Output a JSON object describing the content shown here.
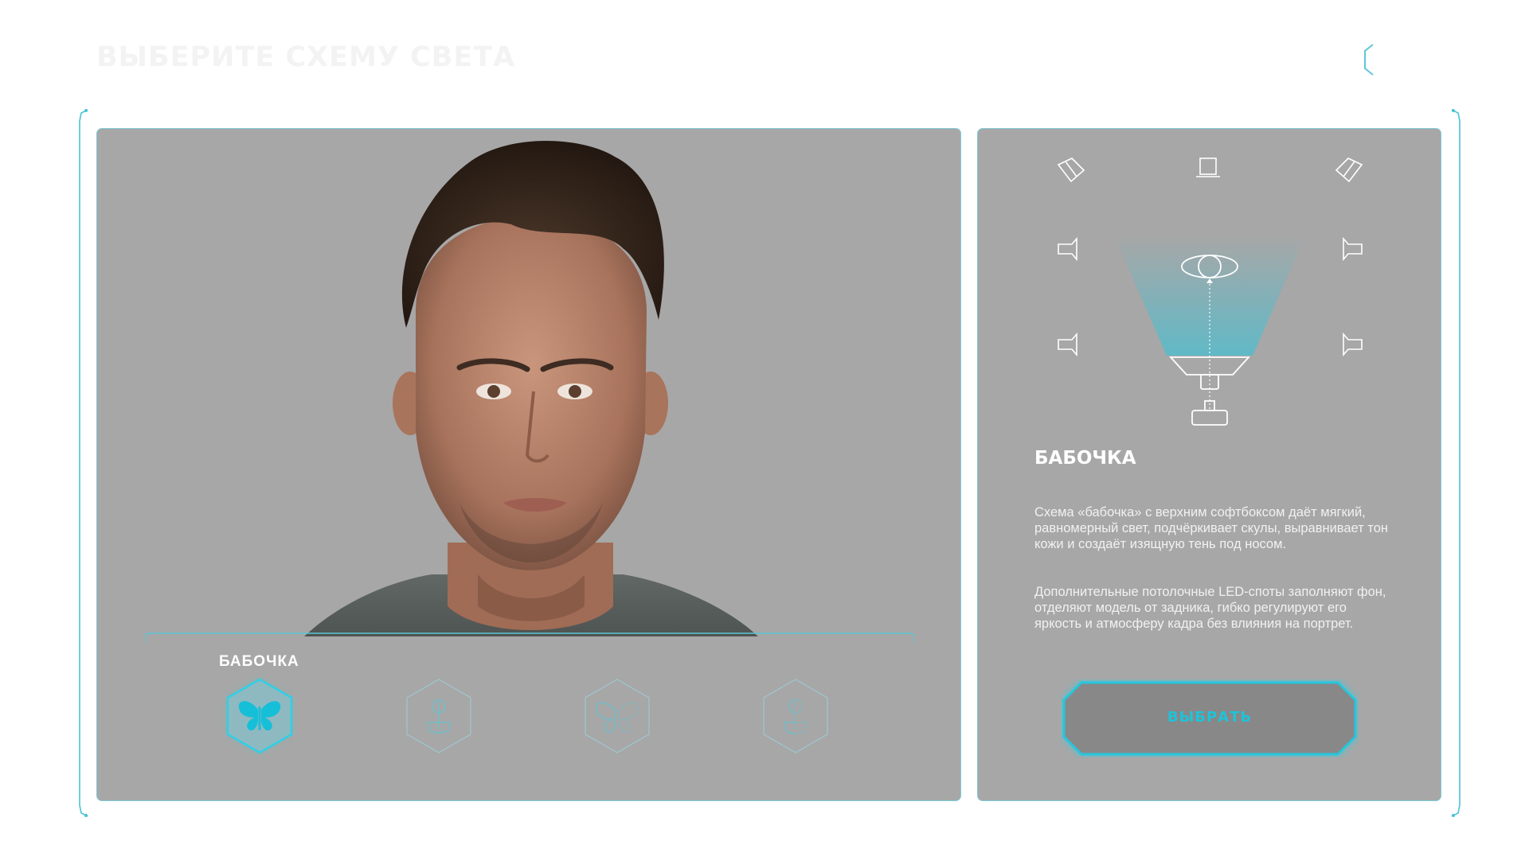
{
  "page": {
    "title": "ВЫБЕРИТЕ СХЕМУ СВЕТА"
  },
  "header": {
    "back_icon": "back-arrow-icon"
  },
  "preview": {
    "image": "portrait-photo-placeholder"
  },
  "scheme_selector": {
    "selected_label": "БАБОЧКА",
    "items": [
      {
        "icon": "butterfly-icon",
        "selected": true
      },
      {
        "icon": "rembrandt-icon",
        "selected": false
      },
      {
        "icon": "split-butterfly-icon",
        "selected": false
      },
      {
        "icon": "split-light-icon",
        "selected": false
      }
    ]
  },
  "details": {
    "title": "БАБОЧКА",
    "paragraph1": "Схема «бабочка» с верхним софтбоксом даёт мягкий, равномерный свет, подчёркивает скулы, выравнивает тон кожи и создаёт изящную тень под носом.",
    "paragraph2": "Дополнительные потолочные LED-споты заполняют фон, отделяют модель от задника, гибко регулируют его яркость и атмосферу кадра без влияния на портрет.",
    "select_button": "ВЫБРАТЬ"
  },
  "colors": {
    "accent": "#1ec3d9",
    "panel": "#a7a7a7",
    "button": "#888888",
    "title_faint": "#f3f3f3"
  }
}
